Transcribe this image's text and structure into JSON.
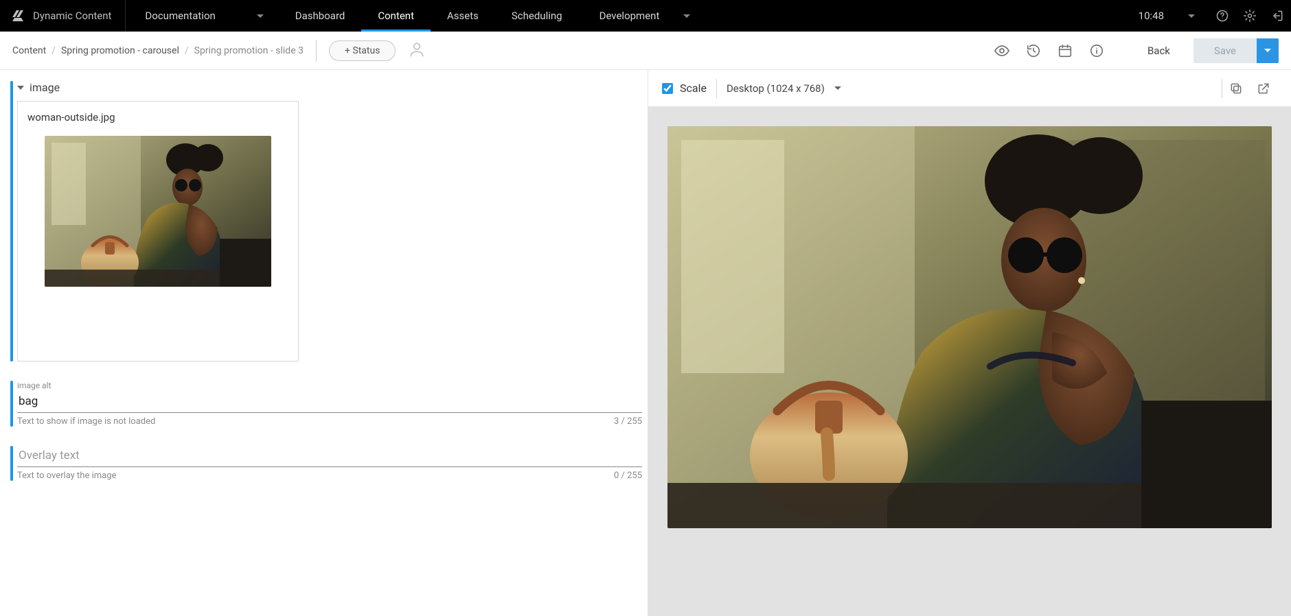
{
  "branding": {
    "app_name": "Dynamic Content"
  },
  "topnav": {
    "docs_label": "Documentation",
    "items": [
      "Dashboard",
      "Content",
      "Assets",
      "Scheduling"
    ],
    "active_index": 1,
    "repo_label": "Development",
    "clock": "10:48"
  },
  "subbar": {
    "breadcrumb": {
      "root": "Content",
      "folder": "Spring promotion - carousel",
      "current": "Spring promotion - slide 3"
    },
    "status_button": "+ Status",
    "back_label": "Back",
    "save_label": "Save"
  },
  "form": {
    "image_section": {
      "title": "image",
      "filename": "woman-outside.jpg"
    },
    "alt_field": {
      "label": "image alt",
      "value": "bag",
      "helper": "Text to show if image is not loaded",
      "counter": "3 / 255"
    },
    "overlay_field": {
      "placeholder": "Overlay text",
      "value": "",
      "helper": "Text to overlay the image",
      "counter": "0 / 255"
    }
  },
  "preview": {
    "scale_label": "Scale",
    "scale_checked": true,
    "device_label": "Desktop (1024 x 768)"
  }
}
